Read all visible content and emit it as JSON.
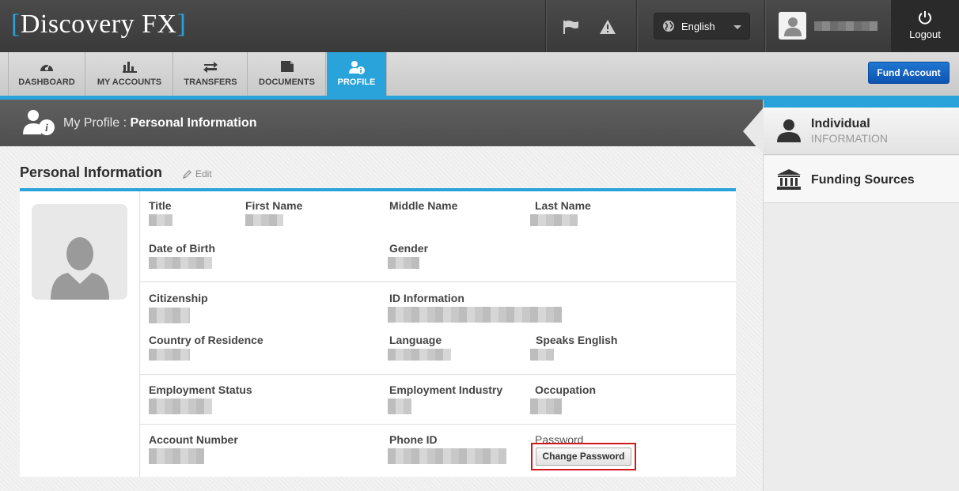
{
  "app": {
    "logo": "Discovery FX",
    "logo_left_bracket": "[",
    "logo_right_bracket": "]"
  },
  "topbar": {
    "icons": [
      "flag-icon",
      "warning-icon"
    ],
    "language": "English",
    "logout_label": "Logout"
  },
  "nav": {
    "tabs": [
      {
        "label": "DASHBOARD",
        "icon": "gauge-icon"
      },
      {
        "label": "MY ACCOUNTS",
        "icon": "bar-chart-icon"
      },
      {
        "label": "TRANSFERS",
        "icon": "transfer-arrows-icon"
      },
      {
        "label": "DOCUMENTS",
        "icon": "document-icon"
      },
      {
        "label": "PROFILE",
        "icon": "profile-info-icon",
        "active": true
      }
    ],
    "fund_account": "Fund Account"
  },
  "header": {
    "prefix": "My Profile : ",
    "title": "Personal Information"
  },
  "section": {
    "title": "Personal Information",
    "edit_label": "Edit"
  },
  "fields": {
    "title": "Title",
    "first_name": "First Name",
    "middle_name": "Middle Name",
    "last_name": "Last Name",
    "dob": "Date of Birth",
    "gender": "Gender",
    "citizenship": "Citizenship",
    "id_information": "ID Information",
    "country": "Country of Residence",
    "language": "Language",
    "speaks_english": "Speaks English",
    "employment_status": "Employment Status",
    "employment_industry": "Employment Industry",
    "occupation": "Occupation",
    "account_number": "Account Number",
    "phone_id": "Phone ID",
    "password": "Password",
    "change_password": "Change Password"
  },
  "sidebar": {
    "items": [
      {
        "title": "Individual",
        "subtitle": "INFORMATION",
        "active": true
      },
      {
        "title": "Funding Sources"
      }
    ]
  },
  "colors": {
    "accent": "#29a3d9",
    "fund_button": "#1565c0",
    "highlight_box": "#d0181e"
  }
}
